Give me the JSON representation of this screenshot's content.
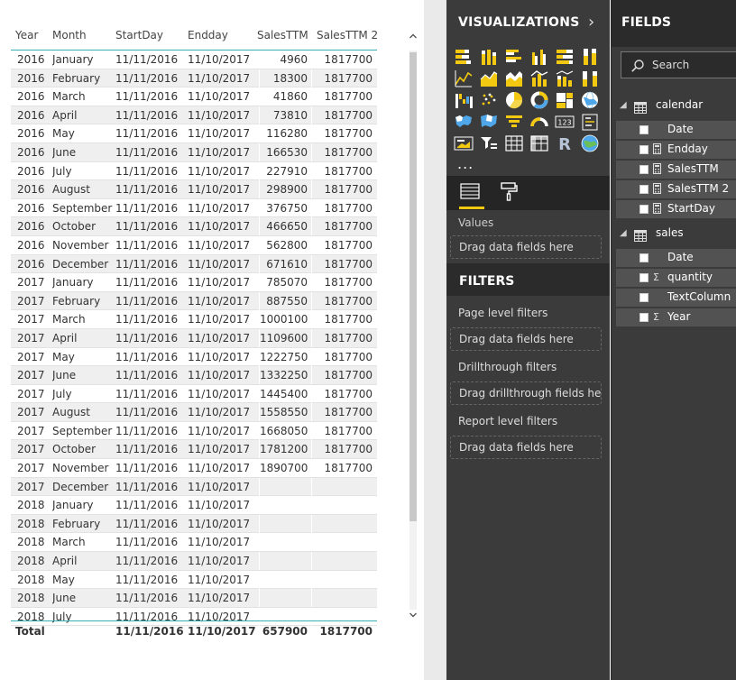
{
  "table": {
    "columns": [
      "Year",
      "Month",
      "StartDay",
      "Endday",
      "SalesTTM",
      "SalesTTM 2"
    ],
    "rows": [
      [
        "2016",
        "January",
        "11/11/2016",
        "11/10/2017",
        "4960",
        "1817700"
      ],
      [
        "2016",
        "February",
        "11/11/2016",
        "11/10/2017",
        "18300",
        "1817700"
      ],
      [
        "2016",
        "March",
        "11/11/2016",
        "11/10/2017",
        "41860",
        "1817700"
      ],
      [
        "2016",
        "April",
        "11/11/2016",
        "11/10/2017",
        "73810",
        "1817700"
      ],
      [
        "2016",
        "May",
        "11/11/2016",
        "11/10/2017",
        "116280",
        "1817700"
      ],
      [
        "2016",
        "June",
        "11/11/2016",
        "11/10/2017",
        "166530",
        "1817700"
      ],
      [
        "2016",
        "July",
        "11/11/2016",
        "11/10/2017",
        "227910",
        "1817700"
      ],
      [
        "2016",
        "August",
        "11/11/2016",
        "11/10/2017",
        "298900",
        "1817700"
      ],
      [
        "2016",
        "September",
        "11/11/2016",
        "11/10/2017",
        "376750",
        "1817700"
      ],
      [
        "2016",
        "October",
        "11/11/2016",
        "11/10/2017",
        "466650",
        "1817700"
      ],
      [
        "2016",
        "November",
        "11/11/2016",
        "11/10/2017",
        "562800",
        "1817700"
      ],
      [
        "2016",
        "December",
        "11/11/2016",
        "11/10/2017",
        "671610",
        "1817700"
      ],
      [
        "2017",
        "January",
        "11/11/2016",
        "11/10/2017",
        "785070",
        "1817700"
      ],
      [
        "2017",
        "February",
        "11/11/2016",
        "11/10/2017",
        "887550",
        "1817700"
      ],
      [
        "2017",
        "March",
        "11/11/2016",
        "11/10/2017",
        "1000100",
        "1817700"
      ],
      [
        "2017",
        "April",
        "11/11/2016",
        "11/10/2017",
        "1109600",
        "1817700"
      ],
      [
        "2017",
        "May",
        "11/11/2016",
        "11/10/2017",
        "1222750",
        "1817700"
      ],
      [
        "2017",
        "June",
        "11/11/2016",
        "11/10/2017",
        "1332250",
        "1817700"
      ],
      [
        "2017",
        "July",
        "11/11/2016",
        "11/10/2017",
        "1445400",
        "1817700"
      ],
      [
        "2017",
        "August",
        "11/11/2016",
        "11/10/2017",
        "1558550",
        "1817700"
      ],
      [
        "2017",
        "September",
        "11/11/2016",
        "11/10/2017",
        "1668050",
        "1817700"
      ],
      [
        "2017",
        "October",
        "11/11/2016",
        "11/10/2017",
        "1781200",
        "1817700"
      ],
      [
        "2017",
        "November",
        "11/11/2016",
        "11/10/2017",
        "1890700",
        "1817700"
      ],
      [
        "2017",
        "December",
        "11/11/2016",
        "11/10/2017",
        "",
        ""
      ],
      [
        "2018",
        "January",
        "11/11/2016",
        "11/10/2017",
        "",
        ""
      ],
      [
        "2018",
        "February",
        "11/11/2016",
        "11/10/2017",
        "",
        ""
      ],
      [
        "2018",
        "March",
        "11/11/2016",
        "11/10/2017",
        "",
        ""
      ],
      [
        "2018",
        "April",
        "11/11/2016",
        "11/10/2017",
        "",
        ""
      ],
      [
        "2018",
        "May",
        "11/11/2016",
        "11/10/2017",
        "",
        ""
      ],
      [
        "2018",
        "June",
        "11/11/2016",
        "11/10/2017",
        "",
        ""
      ],
      [
        "2018",
        "July",
        "11/11/2016",
        "11/10/2017",
        "",
        ""
      ]
    ],
    "total": {
      "label": "Total",
      "startday": "11/11/2016",
      "endday": "11/10/2017",
      "salesttm": "657900",
      "salesttm2": "1817700"
    },
    "scroll_up_icon": "chevron-up-icon",
    "scroll_down_icon": "chevron-down-icon"
  },
  "visualizations": {
    "title": "VISUALIZATIONS",
    "collapse_glyph": "›",
    "more_glyph": "...",
    "icon_names": [
      "stacked-bar-icon",
      "stacked-column-icon",
      "clustered-bar-icon",
      "clustered-column-icon",
      "100-stacked-bar-icon",
      "100-stacked-column-icon",
      "line-icon",
      "area-icon",
      "stacked-area-icon",
      "line-clustered-column-icon",
      "line-stacked-column-icon",
      "ribbon-icon",
      "waterfall-icon",
      "scatter-icon",
      "pie-icon",
      "donut-icon",
      "treemap-icon",
      "globe-map-icon",
      "filled-map-icon",
      "shape-map-icon",
      "funnel-icon",
      "gauge-icon",
      "card-icon",
      "multi-row-card-icon",
      "kpi-icon",
      "slicer-icon",
      "table-icon",
      "matrix-icon",
      "r-visual-icon",
      "arcgis-icon"
    ],
    "r_label": "R",
    "card_label": "123",
    "values_label": "Values",
    "values_drop": "Drag data fields here"
  },
  "filters": {
    "title": "FILTERS",
    "page_label": "Page level filters",
    "page_drop": "Drag data fields here",
    "drill_label": "Drillthrough filters",
    "drill_drop": "Drag drillthrough fields here",
    "report_label": "Report level filters",
    "report_drop": "Drag data fields here"
  },
  "fields": {
    "title": "FIELDS",
    "search_placeholder": "Search",
    "tables": [
      {
        "name": "calendar",
        "fields": [
          {
            "name": "Date",
            "type": ""
          },
          {
            "name": "Endday",
            "type": "calc"
          },
          {
            "name": "SalesTTM",
            "type": "calc"
          },
          {
            "name": "SalesTTM 2",
            "type": "calc"
          },
          {
            "name": "StartDay",
            "type": "calc"
          }
        ]
      },
      {
        "name": "sales",
        "fields": [
          {
            "name": "Date",
            "type": ""
          },
          {
            "name": "quantity",
            "type": "sum"
          },
          {
            "name": "TextColumn",
            "type": ""
          },
          {
            "name": "Year",
            "type": "sum"
          }
        ]
      }
    ],
    "sum_glyph": "Σ"
  },
  "colors": {
    "accent": "#3ab0b4",
    "pane_bg": "#3b3b3b",
    "tab_highlight": "#f2c811",
    "icon_yellow": "#f2c811",
    "icon_blue": "#4fa6e8"
  }
}
